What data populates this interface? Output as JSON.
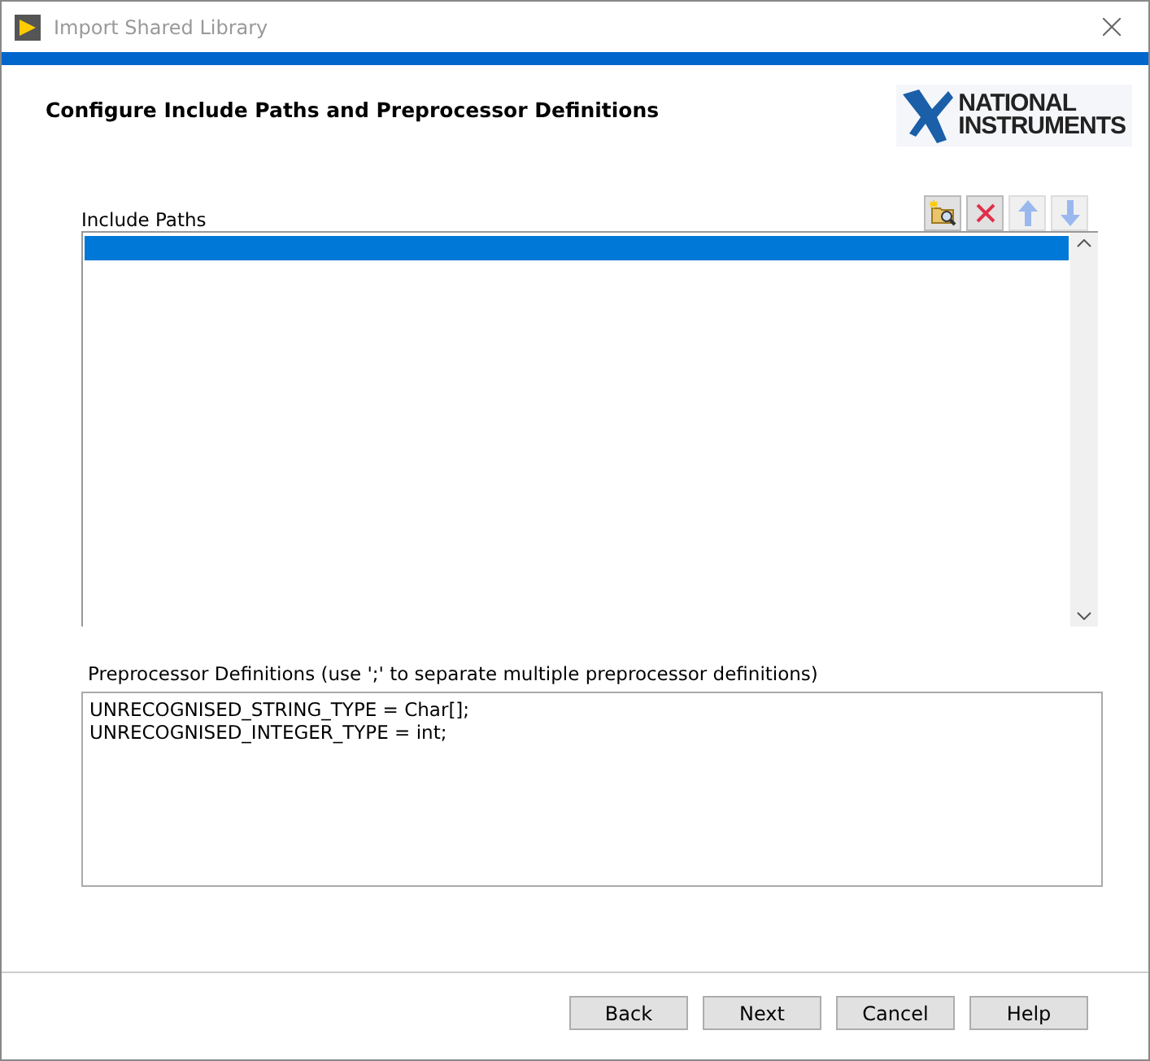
{
  "window": {
    "title": "Import Shared Library"
  },
  "header": {
    "title": "Configure Include Paths and Preprocessor Definitions",
    "logo": [
      "NATIONAL",
      "INSTRUMENTS"
    ]
  },
  "include_paths": {
    "label": "Include Paths",
    "toolbar": [
      {
        "kind": "add",
        "disabled": false
      },
      {
        "kind": "delete",
        "disabled": false
      },
      {
        "kind": "up",
        "disabled": true
      },
      {
        "kind": "down",
        "disabled": true
      }
    ],
    "rows": [
      {
        "text": "",
        "selected": true
      }
    ]
  },
  "definitions": {
    "label": "Preprocessor Definitions (use ';' to separate multiple preprocessor definitions)",
    "lines": [
      "UNRECOGNISED_STRING_TYPE = Char[];",
      "UNRECOGNISED_INTEGER_TYPE = int;"
    ]
  },
  "buttons": [
    "Back",
    "Next",
    "Cancel",
    "Help"
  ]
}
